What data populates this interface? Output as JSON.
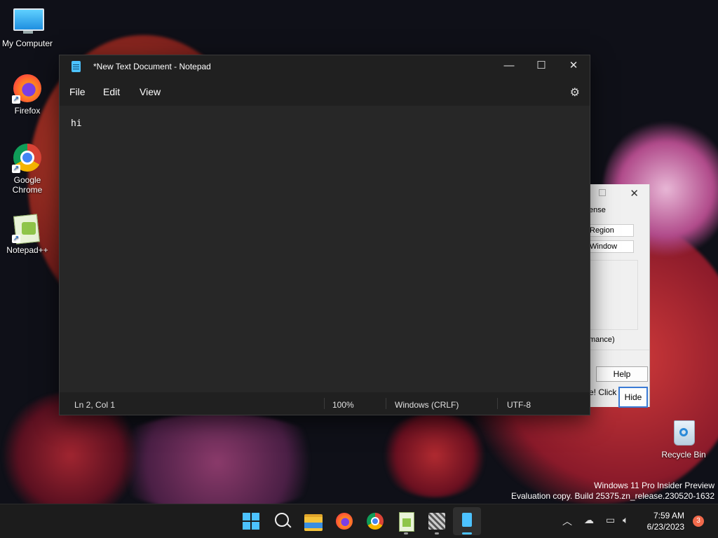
{
  "desktop": {
    "icons": [
      {
        "label": "My Computer"
      },
      {
        "label": "Firefox"
      },
      {
        "label": "Google Chrome"
      },
      {
        "label": "Notepad++"
      }
    ],
    "recycle_bin": "Recycle Bin",
    "watermark_line1": "Windows 11 Pro Insider Preview",
    "watermark_line2": "Evaluation copy. Build 25375.zn_release.230520-1632"
  },
  "notepad": {
    "title": "*New Text Document - Notepad",
    "menu": {
      "file": "File",
      "edit": "Edit",
      "view": "View"
    },
    "content": "hi",
    "status": {
      "position": "Ln 2, Col 1",
      "zoom": "100%",
      "line_ending": "Windows (CRLF)",
      "encoding": "UTF-8"
    },
    "controls": {
      "minimize": "—",
      "maximize": "☐",
      "close": "✕"
    }
  },
  "background_dialog": {
    "title_fragment": "ense",
    "field1": "Region",
    "field2": "Window",
    "text1": "mance)",
    "help_button": "Help",
    "text2": "e! Click",
    "hide_button": "Hide"
  },
  "taskbar": {
    "clock_time": "7:59 AM",
    "clock_date": "6/23/2023",
    "notification_count": "3"
  },
  "colors": {
    "accent": "#4cc2ff",
    "taskbar": "#1c1c1c",
    "notepad_bg": "#272727"
  }
}
